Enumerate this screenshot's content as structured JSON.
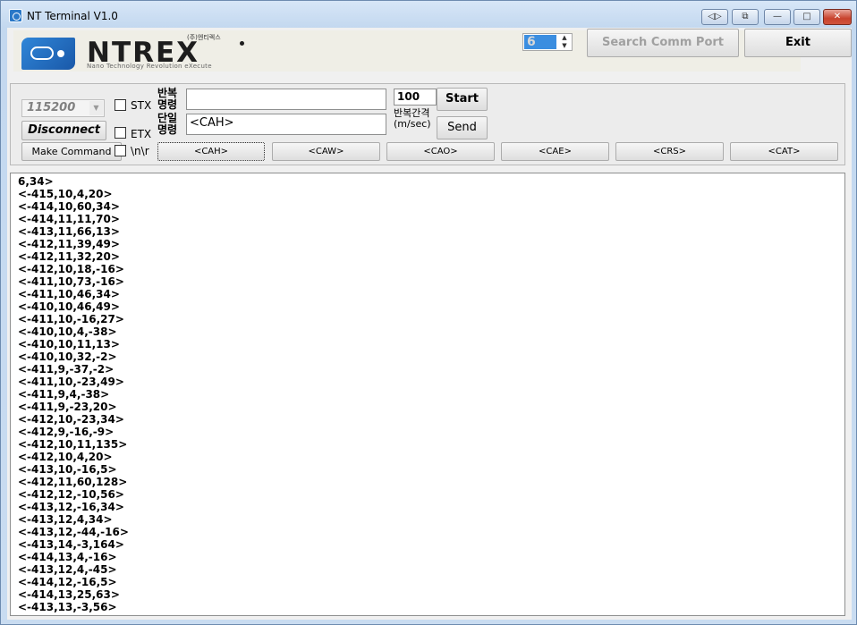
{
  "window": {
    "title": "NT Terminal V1.0",
    "caption_buttons": {
      "extra1": "◁▷",
      "extra2": "⧉",
      "minimize": "—",
      "maximize": "□",
      "close": "✕"
    }
  },
  "banner": {
    "logo_text": "NTREX",
    "logo_korean": "(주)엔티렉스",
    "logo_tagline": "Nano Technology Revolution eXecute"
  },
  "top_controls": {
    "port_number": "6",
    "search_button": "Search Comm Port",
    "exit_button": "Exit"
  },
  "controls": {
    "baud_rate": "115200",
    "disconnect_button": "Disconnect",
    "make_command_button": "Make Command",
    "stx_label": "STX",
    "etx_label": "ETX",
    "newline_label": "\\n\\r",
    "repeat_command_label_1": "반복",
    "repeat_command_label_2": "명령",
    "single_command_label_1": "단일",
    "single_command_label_2": "명령",
    "repeat_command_value": "",
    "single_command_value": "<CAH>",
    "interval_value": "100",
    "interval_label": "반복간격",
    "interval_unit": "(m/sec)",
    "start_button": "Start",
    "send_button": "Send"
  },
  "quick_commands": [
    "<CAH>",
    "<CAW>",
    "<CAO>",
    "<CAE>",
    "<CRS>",
    "<CAT>"
  ],
  "log_lines": [
    "6,34>",
    "<-415,10,4,20>",
    "<-414,10,60,34>",
    "<-414,11,11,70>",
    "<-413,11,66,13>",
    "<-412,11,39,49>",
    "<-412,11,32,20>",
    "<-412,10,18,-16>",
    "<-411,10,73,-16>",
    "<-411,10,46,34>",
    "<-410,10,46,49>",
    "<-411,10,-16,27>",
    "<-410,10,4,-38>",
    "<-410,10,11,13>",
    "<-410,10,32,-2>",
    "<-411,9,-37,-2>",
    "<-411,10,-23,49>",
    "<-411,9,4,-38>",
    "<-411,9,-23,20>",
    "<-412,10,-23,34>",
    "<-412,9,-16,-9>",
    "<-412,10,11,135>",
    "<-412,10,4,20>",
    "<-413,10,-16,5>",
    "<-412,11,60,128>",
    "<-412,12,-10,56>",
    "<-413,12,-16,34>",
    "<-413,12,4,34>",
    "<-413,12,-44,-16>",
    "<-413,14,-3,164>",
    "<-414,13,4,-16>",
    "<-413,12,4,-45>",
    "<-414,12,-16,5>",
    "<-414,13,25,63>",
    "<-413,13,-3,56>"
  ]
}
